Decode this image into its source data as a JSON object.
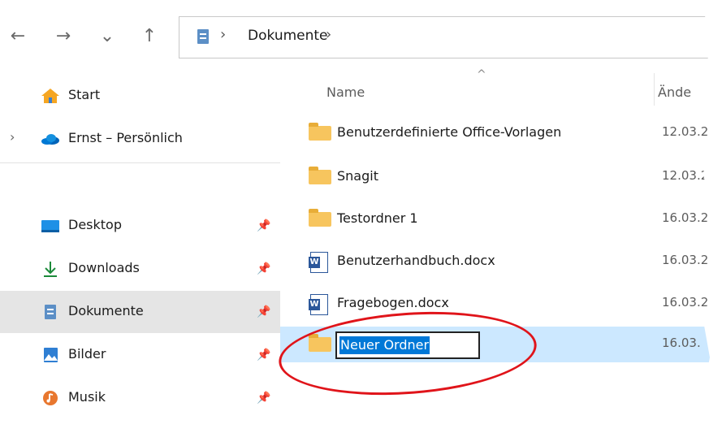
{
  "nav": {
    "back": "←",
    "forward": "→",
    "recent": "⌄",
    "up": "↑"
  },
  "address": {
    "separator": "›",
    "path": "Dokumente",
    "trail": "›"
  },
  "sidebar": {
    "items": [
      {
        "label": "Start",
        "icon": "home-icon"
      },
      {
        "label": "Ernst – Persönlich",
        "icon": "onedrive-icon"
      },
      {
        "label": "Desktop",
        "icon": "desktop-icon",
        "pinned": true
      },
      {
        "label": "Downloads",
        "icon": "download-icon",
        "pinned": true
      },
      {
        "label": "Dokumente",
        "icon": "document-icon",
        "pinned": true,
        "selected": true
      },
      {
        "label": "Bilder",
        "icon": "pictures-icon",
        "pinned": true
      },
      {
        "label": "Musik",
        "icon": "music-icon",
        "pinned": true
      }
    ]
  },
  "columns": {
    "name": "Name",
    "date": "Ände",
    "sort": "^"
  },
  "files": [
    {
      "name": "Benutzerdefinierte Office-Vorlagen",
      "type": "folder",
      "date": "12.03.2"
    },
    {
      "name": "Snagit",
      "type": "folder",
      "date": "12.03.2"
    },
    {
      "name": "Testordner 1",
      "type": "folder",
      "date": "16.03.2"
    },
    {
      "name": "Benutzerhandbuch.docx",
      "type": "docx",
      "date": "16.03.2"
    },
    {
      "name": "Fragebogen.docx",
      "type": "docx",
      "date": "16.03.2"
    },
    {
      "name": "Neuer Ordner",
      "type": "folder",
      "date": "16.03.",
      "renaming": true
    }
  ],
  "colors": {
    "selected_row": "#cce8ff",
    "sidebar_selected": "#e5e5e5",
    "highlight_ellipse": "#e0141a",
    "text_selection": "#0078d7"
  }
}
